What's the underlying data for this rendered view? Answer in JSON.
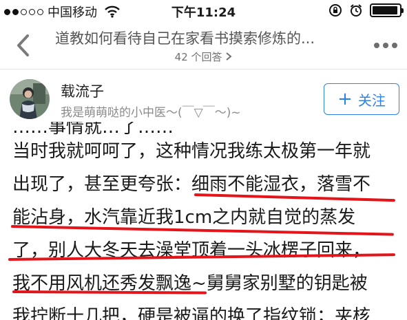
{
  "status_bar": {
    "carrier": "中国移动",
    "time": "下午11:24",
    "signal_dots": 5,
    "signal_filled": 2,
    "battery_level": 0.96
  },
  "nav": {
    "title": "道教如何看待自己在家看书摸索修炼的...",
    "answer_count": "42 个回答"
  },
  "author": {
    "name": "载流子",
    "bio": "我是萌萌哒的小中医～(￣▽￣～)~",
    "follow_label": "关注"
  },
  "content": {
    "cut_line": "……事情就…了……",
    "lines": [
      "当时我就呵呵了，这种情况我练太极第一年就",
      "出现了，甚至更夸张：细雨不能湿衣，落雪不",
      "能沾身，水汽靠近我1cm之内就自觉的蒸发",
      "了，别人大冬天去澡堂顶着一头冰楞子回来，",
      "我不用风机还秀发飘逸~舅舅家别墅的钥匙被",
      "我拧断十几把，硬是被逼的换了指纹锁；夹核"
    ]
  },
  "colors": {
    "accent": "#2e82e6",
    "underline": "#e3151a"
  }
}
